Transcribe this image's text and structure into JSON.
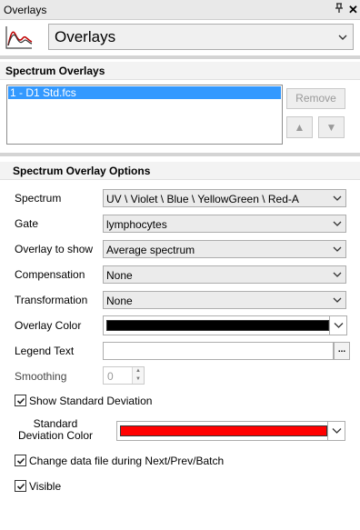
{
  "window": {
    "title": "Overlays"
  },
  "header": {
    "selected": "Overlays"
  },
  "spectrum_overlays": {
    "heading": "Spectrum Overlays",
    "items": [
      "1 - D1 Std.fcs"
    ],
    "remove_label": "Remove",
    "up_glyph": "▲",
    "down_glyph": "▼"
  },
  "options": {
    "heading": "Spectrum Overlay Options",
    "spectrum": {
      "label": "Spectrum",
      "value": "UV \\ Violet \\ Blue \\ YellowGreen \\ Red-A"
    },
    "gate": {
      "label": "Gate",
      "value": "lymphocytes"
    },
    "overlay_to_show": {
      "label": "Overlay to show",
      "value": "Average spectrum"
    },
    "compensation": {
      "label": "Compensation",
      "value": "None"
    },
    "transformation": {
      "label": "Transformation",
      "value": "None"
    },
    "overlay_color": {
      "label": "Overlay Color",
      "color": "#000000"
    },
    "legend_text": {
      "label": "Legend Text",
      "value": "",
      "button": "..."
    },
    "smoothing": {
      "label": "Smoothing",
      "value": "0"
    },
    "show_std_dev": {
      "label": "Show Standard Deviation",
      "checked": true
    },
    "std_dev_color": {
      "label": "Standard Deviation Color",
      "color": "#ff0000"
    },
    "change_data_file": {
      "label": "Change data file during Next/Prev/Batch",
      "checked": true
    },
    "visible": {
      "label": "Visible",
      "checked": true
    }
  },
  "icons": {
    "pin": "pin-icon",
    "close": "close-icon",
    "app": "spectrum-overlay-icon",
    "dropdown": "chevron-down-icon",
    "check": "checkmark-icon"
  }
}
